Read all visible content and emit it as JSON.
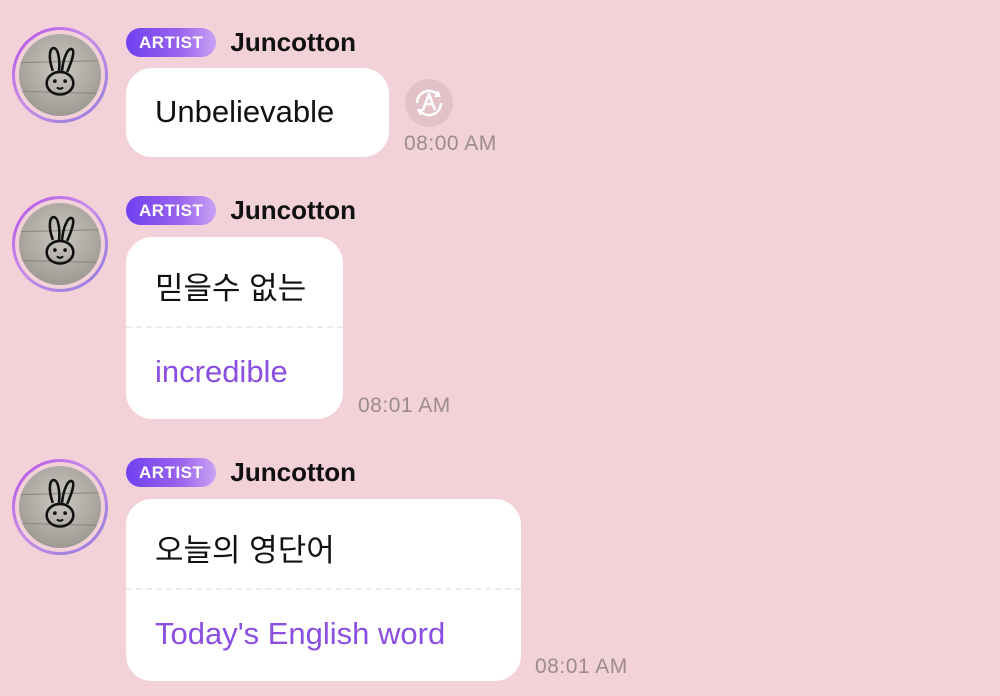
{
  "messages": [
    {
      "badge": "ARTIST",
      "sender": "Juncotton",
      "text": "Unbelievable",
      "time": "08:00 AM",
      "has_translate_button": true
    },
    {
      "badge": "ARTIST",
      "sender": "Juncotton",
      "text": "믿을수 없는",
      "translation": "incredible",
      "time": "08:01 AM"
    },
    {
      "badge": "ARTIST",
      "sender": "Juncotton",
      "text": "오늘의 영단어",
      "translation": "Today's English word",
      "time": "08:01 AM"
    }
  ],
  "icons": {
    "translate": "translate-icon",
    "avatar": "bunny-drawing"
  },
  "colors": {
    "background": "#f2d1d9",
    "badge_start": "#6f41f0",
    "badge_end": "#c9a2f4",
    "translation_text": "#8a4fe0",
    "timestamp": "#9c8b8f"
  }
}
